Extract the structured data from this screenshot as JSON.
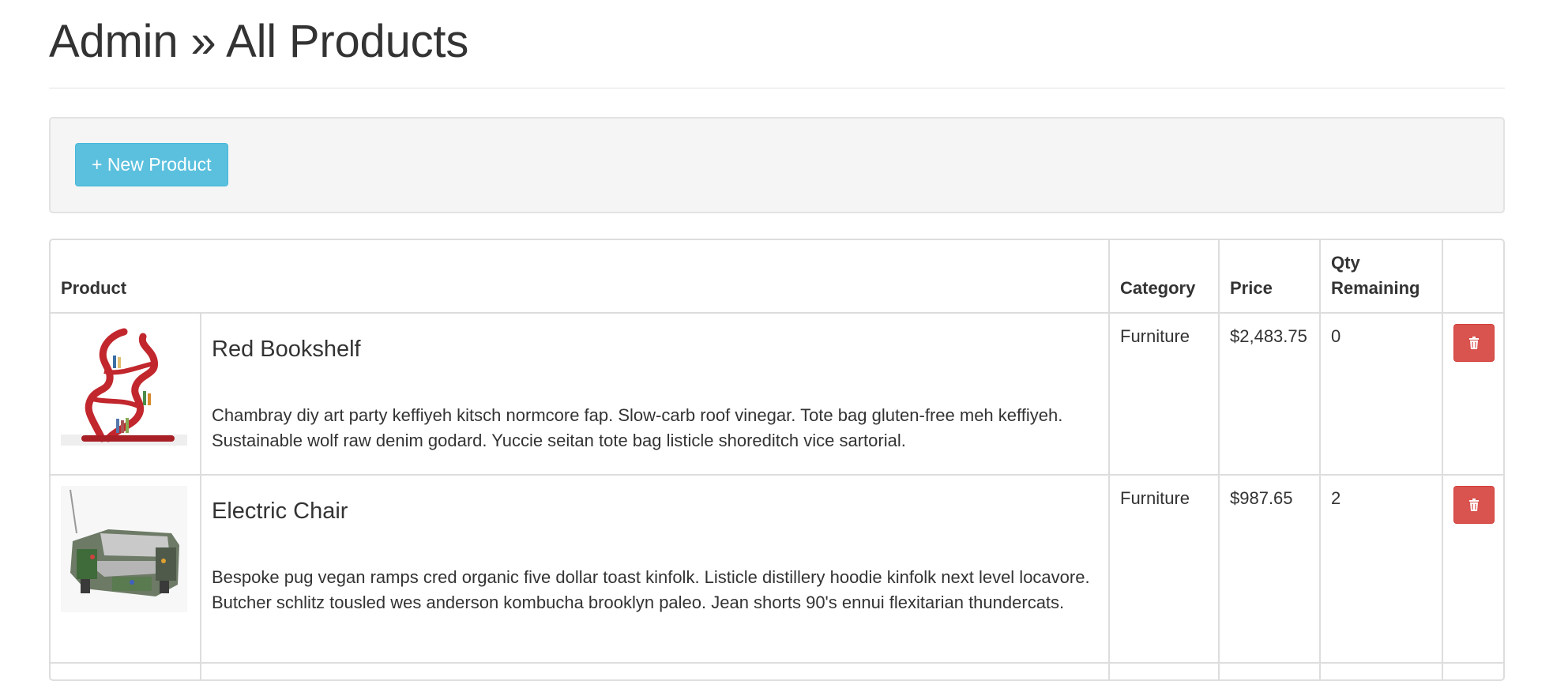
{
  "header": {
    "title": "Admin » All Products"
  },
  "toolbar": {
    "new_product_label": "+ New Product"
  },
  "table": {
    "columns": {
      "product": "Product",
      "category": "Category",
      "price": "Price",
      "qty_line1": "Qty",
      "qty_line2": "Remaining"
    },
    "rows": [
      {
        "name": "Red Bookshelf",
        "description": "Chambray diy art party keffiyeh kitsch normcore fap. Slow-carb roof vinegar. Tote bag gluten-free meh keffiyeh. Sustainable wolf raw denim godard. Yuccie seitan tote bag listicle shoreditch vice sartorial.",
        "category": "Furniture",
        "price": "$2,483.75",
        "qty": "0",
        "thumb_icon": "bookshelf-image"
      },
      {
        "name": "Electric Chair",
        "description": "Bespoke pug vegan ramps cred organic five dollar toast kinfolk. Listicle distillery hoodie kinfolk next level locavore. Butcher schlitz tousled wes anderson kombucha brooklyn paleo. Jean shorts 90's ennui flexitarian thundercats.",
        "category": "Furniture",
        "price": "$987.65",
        "qty": "2",
        "thumb_icon": "chair-image"
      }
    ]
  },
  "colors": {
    "info_button": "#5bc0de",
    "danger_button": "#d9534f",
    "border": "#dddddd",
    "well_bg": "#f5f5f5"
  }
}
